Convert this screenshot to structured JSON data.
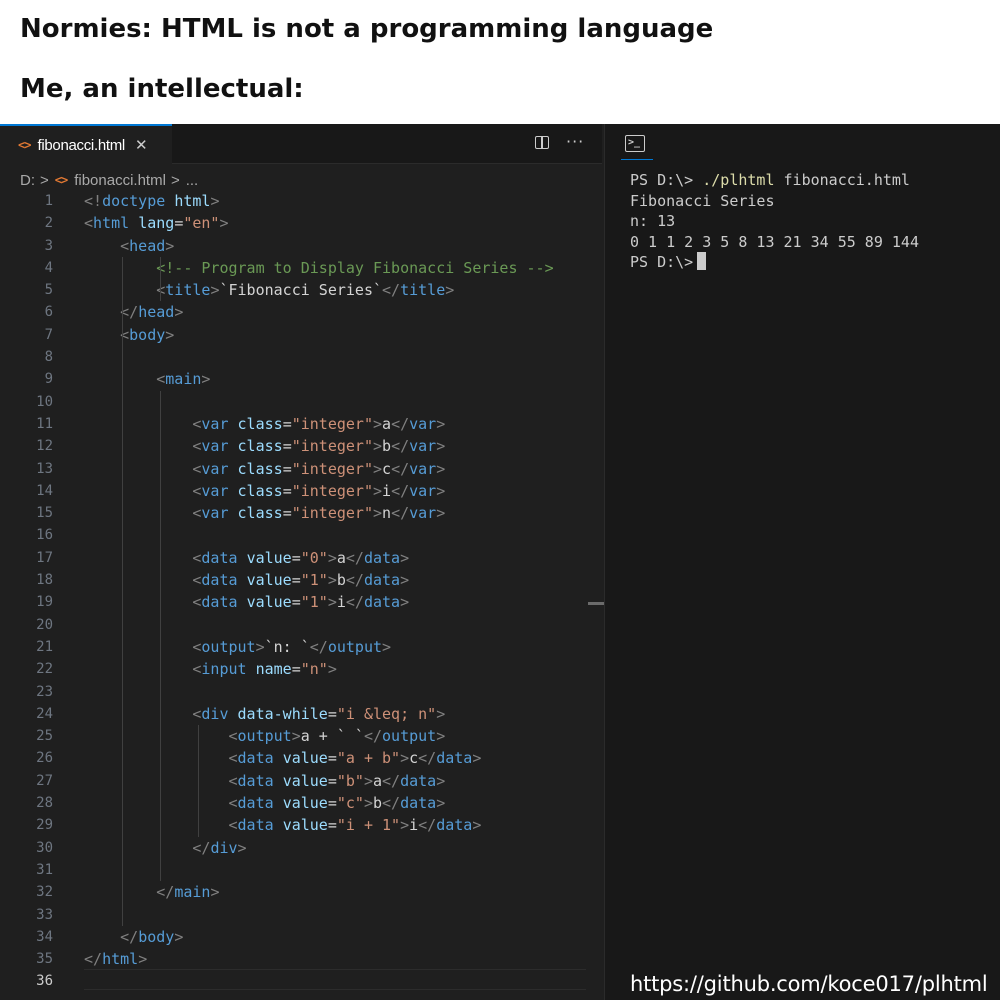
{
  "meme": {
    "caption_top": "Normies: HTML is not a programming language",
    "caption_bottom": "Me, an intellectual:"
  },
  "editor": {
    "tab": {
      "icon": "html-file-icon",
      "label": "fibonacci.html",
      "close": "✕"
    },
    "actions": {
      "split": "split-editor-icon",
      "more": "···"
    },
    "breadcrumb": {
      "drive": "D:",
      "sep": ">",
      "file": "fibonacci.html",
      "tail": "..."
    },
    "lines": [
      {
        "n": "1",
        "segs": [
          [
            "p",
            "<!"
          ],
          [
            "t",
            "doctype"
          ],
          [
            "x",
            " "
          ],
          [
            "a",
            "html"
          ],
          [
            "p",
            ">"
          ]
        ]
      },
      {
        "n": "2",
        "segs": [
          [
            "p",
            "<"
          ],
          [
            "t",
            "html"
          ],
          [
            "x",
            " "
          ],
          [
            "a",
            "lang"
          ],
          [
            "x",
            "="
          ],
          [
            "s",
            "\"en\""
          ],
          [
            "p",
            ">"
          ]
        ]
      },
      {
        "n": "3",
        "segs": [
          [
            "x",
            "    "
          ],
          [
            "p",
            "<"
          ],
          [
            "t",
            "head"
          ],
          [
            "p",
            ">"
          ]
        ]
      },
      {
        "n": "4",
        "segs": [
          [
            "x",
            "        "
          ],
          [
            "c",
            "<!-- Program to Display Fibonacci Series -->"
          ]
        ]
      },
      {
        "n": "5",
        "segs": [
          [
            "x",
            "        "
          ],
          [
            "p",
            "<"
          ],
          [
            "t",
            "title"
          ],
          [
            "p",
            ">"
          ],
          [
            "x",
            "`Fibonacci Series`"
          ],
          [
            "p",
            "</"
          ],
          [
            "t",
            "title"
          ],
          [
            "p",
            ">"
          ]
        ]
      },
      {
        "n": "6",
        "segs": [
          [
            "x",
            "    "
          ],
          [
            "p",
            "</"
          ],
          [
            "t",
            "head"
          ],
          [
            "p",
            ">"
          ]
        ]
      },
      {
        "n": "7",
        "segs": [
          [
            "x",
            "    "
          ],
          [
            "p",
            "<"
          ],
          [
            "t",
            "body"
          ],
          [
            "p",
            ">"
          ]
        ]
      },
      {
        "n": "8",
        "segs": []
      },
      {
        "n": "9",
        "segs": [
          [
            "x",
            "        "
          ],
          [
            "p",
            "<"
          ],
          [
            "t",
            "main"
          ],
          [
            "p",
            ">"
          ]
        ]
      },
      {
        "n": "10",
        "segs": []
      },
      {
        "n": "11",
        "segs": [
          [
            "x",
            "            "
          ],
          [
            "p",
            "<"
          ],
          [
            "t",
            "var"
          ],
          [
            "x",
            " "
          ],
          [
            "a",
            "class"
          ],
          [
            "x",
            "="
          ],
          [
            "s",
            "\"integer\""
          ],
          [
            "p",
            ">"
          ],
          [
            "x",
            "a"
          ],
          [
            "p",
            "</"
          ],
          [
            "t",
            "var"
          ],
          [
            "p",
            ">"
          ]
        ]
      },
      {
        "n": "12",
        "segs": [
          [
            "x",
            "            "
          ],
          [
            "p",
            "<"
          ],
          [
            "t",
            "var"
          ],
          [
            "x",
            " "
          ],
          [
            "a",
            "class"
          ],
          [
            "x",
            "="
          ],
          [
            "s",
            "\"integer\""
          ],
          [
            "p",
            ">"
          ],
          [
            "x",
            "b"
          ],
          [
            "p",
            "</"
          ],
          [
            "t",
            "var"
          ],
          [
            "p",
            ">"
          ]
        ]
      },
      {
        "n": "13",
        "segs": [
          [
            "x",
            "            "
          ],
          [
            "p",
            "<"
          ],
          [
            "t",
            "var"
          ],
          [
            "x",
            " "
          ],
          [
            "a",
            "class"
          ],
          [
            "x",
            "="
          ],
          [
            "s",
            "\"integer\""
          ],
          [
            "p",
            ">"
          ],
          [
            "x",
            "c"
          ],
          [
            "p",
            "</"
          ],
          [
            "t",
            "var"
          ],
          [
            "p",
            ">"
          ]
        ]
      },
      {
        "n": "14",
        "segs": [
          [
            "x",
            "            "
          ],
          [
            "p",
            "<"
          ],
          [
            "t",
            "var"
          ],
          [
            "x",
            " "
          ],
          [
            "a",
            "class"
          ],
          [
            "x",
            "="
          ],
          [
            "s",
            "\"integer\""
          ],
          [
            "p",
            ">"
          ],
          [
            "x",
            "i"
          ],
          [
            "p",
            "</"
          ],
          [
            "t",
            "var"
          ],
          [
            "p",
            ">"
          ]
        ]
      },
      {
        "n": "15",
        "segs": [
          [
            "x",
            "            "
          ],
          [
            "p",
            "<"
          ],
          [
            "t",
            "var"
          ],
          [
            "x",
            " "
          ],
          [
            "a",
            "class"
          ],
          [
            "x",
            "="
          ],
          [
            "s",
            "\"integer\""
          ],
          [
            "p",
            ">"
          ],
          [
            "x",
            "n"
          ],
          [
            "p",
            "</"
          ],
          [
            "t",
            "var"
          ],
          [
            "p",
            ">"
          ]
        ]
      },
      {
        "n": "16",
        "segs": []
      },
      {
        "n": "17",
        "segs": [
          [
            "x",
            "            "
          ],
          [
            "p",
            "<"
          ],
          [
            "t",
            "data"
          ],
          [
            "x",
            " "
          ],
          [
            "a",
            "value"
          ],
          [
            "x",
            "="
          ],
          [
            "s",
            "\"0\""
          ],
          [
            "p",
            ">"
          ],
          [
            "x",
            "a"
          ],
          [
            "p",
            "</"
          ],
          [
            "t",
            "data"
          ],
          [
            "p",
            ">"
          ]
        ]
      },
      {
        "n": "18",
        "segs": [
          [
            "x",
            "            "
          ],
          [
            "p",
            "<"
          ],
          [
            "t",
            "data"
          ],
          [
            "x",
            " "
          ],
          [
            "a",
            "value"
          ],
          [
            "x",
            "="
          ],
          [
            "s",
            "\"1\""
          ],
          [
            "p",
            ">"
          ],
          [
            "x",
            "b"
          ],
          [
            "p",
            "</"
          ],
          [
            "t",
            "data"
          ],
          [
            "p",
            ">"
          ]
        ]
      },
      {
        "n": "19",
        "segs": [
          [
            "x",
            "            "
          ],
          [
            "p",
            "<"
          ],
          [
            "t",
            "data"
          ],
          [
            "x",
            " "
          ],
          [
            "a",
            "value"
          ],
          [
            "x",
            "="
          ],
          [
            "s",
            "\"1\""
          ],
          [
            "p",
            ">"
          ],
          [
            "x",
            "i"
          ],
          [
            "p",
            "</"
          ],
          [
            "t",
            "data"
          ],
          [
            "p",
            ">"
          ]
        ]
      },
      {
        "n": "20",
        "segs": []
      },
      {
        "n": "21",
        "segs": [
          [
            "x",
            "            "
          ],
          [
            "p",
            "<"
          ],
          [
            "t",
            "output"
          ],
          [
            "p",
            ">"
          ],
          [
            "x",
            "`n: `"
          ],
          [
            "p",
            "</"
          ],
          [
            "t",
            "output"
          ],
          [
            "p",
            ">"
          ]
        ]
      },
      {
        "n": "22",
        "segs": [
          [
            "x",
            "            "
          ],
          [
            "p",
            "<"
          ],
          [
            "t",
            "input"
          ],
          [
            "x",
            " "
          ],
          [
            "a",
            "name"
          ],
          [
            "x",
            "="
          ],
          [
            "s",
            "\"n\""
          ],
          [
            "p",
            ">"
          ]
        ]
      },
      {
        "n": "23",
        "segs": []
      },
      {
        "n": "24",
        "segs": [
          [
            "x",
            "            "
          ],
          [
            "p",
            "<"
          ],
          [
            "t",
            "div"
          ],
          [
            "x",
            " "
          ],
          [
            "a",
            "data-while"
          ],
          [
            "x",
            "="
          ],
          [
            "s",
            "\"i &leq; n\""
          ],
          [
            "p",
            ">"
          ]
        ]
      },
      {
        "n": "25",
        "segs": [
          [
            "x",
            "                "
          ],
          [
            "p",
            "<"
          ],
          [
            "t",
            "output"
          ],
          [
            "p",
            ">"
          ],
          [
            "x",
            "a + ` `"
          ],
          [
            "p",
            "</"
          ],
          [
            "t",
            "output"
          ],
          [
            "p",
            ">"
          ]
        ]
      },
      {
        "n": "26",
        "segs": [
          [
            "x",
            "                "
          ],
          [
            "p",
            "<"
          ],
          [
            "t",
            "data"
          ],
          [
            "x",
            " "
          ],
          [
            "a",
            "value"
          ],
          [
            "x",
            "="
          ],
          [
            "s",
            "\"a + b\""
          ],
          [
            "p",
            ">"
          ],
          [
            "x",
            "c"
          ],
          [
            "p",
            "</"
          ],
          [
            "t",
            "data"
          ],
          [
            "p",
            ">"
          ]
        ]
      },
      {
        "n": "27",
        "segs": [
          [
            "x",
            "                "
          ],
          [
            "p",
            "<"
          ],
          [
            "t",
            "data"
          ],
          [
            "x",
            " "
          ],
          [
            "a",
            "value"
          ],
          [
            "x",
            "="
          ],
          [
            "s",
            "\"b\""
          ],
          [
            "p",
            ">"
          ],
          [
            "x",
            "a"
          ],
          [
            "p",
            "</"
          ],
          [
            "t",
            "data"
          ],
          [
            "p",
            ">"
          ]
        ]
      },
      {
        "n": "28",
        "segs": [
          [
            "x",
            "                "
          ],
          [
            "p",
            "<"
          ],
          [
            "t",
            "data"
          ],
          [
            "x",
            " "
          ],
          [
            "a",
            "value"
          ],
          [
            "x",
            "="
          ],
          [
            "s",
            "\"c\""
          ],
          [
            "p",
            ">"
          ],
          [
            "x",
            "b"
          ],
          [
            "p",
            "</"
          ],
          [
            "t",
            "data"
          ],
          [
            "p",
            ">"
          ]
        ]
      },
      {
        "n": "29",
        "segs": [
          [
            "x",
            "                "
          ],
          [
            "p",
            "<"
          ],
          [
            "t",
            "data"
          ],
          [
            "x",
            " "
          ],
          [
            "a",
            "value"
          ],
          [
            "x",
            "="
          ],
          [
            "s",
            "\"i + 1\""
          ],
          [
            "p",
            ">"
          ],
          [
            "x",
            "i"
          ],
          [
            "p",
            "</"
          ],
          [
            "t",
            "data"
          ],
          [
            "p",
            ">"
          ]
        ]
      },
      {
        "n": "30",
        "segs": [
          [
            "x",
            "            "
          ],
          [
            "p",
            "</"
          ],
          [
            "t",
            "div"
          ],
          [
            "p",
            ">"
          ]
        ]
      },
      {
        "n": "31",
        "segs": []
      },
      {
        "n": "32",
        "segs": [
          [
            "x",
            "        "
          ],
          [
            "p",
            "</"
          ],
          [
            "t",
            "main"
          ],
          [
            "p",
            ">"
          ]
        ]
      },
      {
        "n": "33",
        "segs": []
      },
      {
        "n": "34",
        "segs": [
          [
            "x",
            "    "
          ],
          [
            "p",
            "</"
          ],
          [
            "t",
            "body"
          ],
          [
            "p",
            ">"
          ]
        ]
      },
      {
        "n": "35",
        "segs": [
          [
            "p",
            "</"
          ],
          [
            "t",
            "html"
          ],
          [
            "p",
            ">"
          ]
        ]
      },
      {
        "n": "36",
        "segs": []
      }
    ]
  },
  "terminal": {
    "icon": "terminal-icon",
    "prompt": "PS D:\\>",
    "command": "./plhtml",
    "command_arg": "fibonacci.html",
    "output_title": "Fibonacci Series",
    "output_n": "n: 13",
    "output_series": "0 1 1 2 3 5 8 13 21 34 55 89 144",
    "prompt_end": "PS D:\\>"
  },
  "watermark": "https://github.com/koce017/plhtml",
  "colors": {
    "tag": "#569cd6",
    "attribute": "#9cdcfe",
    "string": "#ce9178",
    "comment": "#6a9955",
    "punctuation": "#808080",
    "accent": "#0078d4"
  }
}
